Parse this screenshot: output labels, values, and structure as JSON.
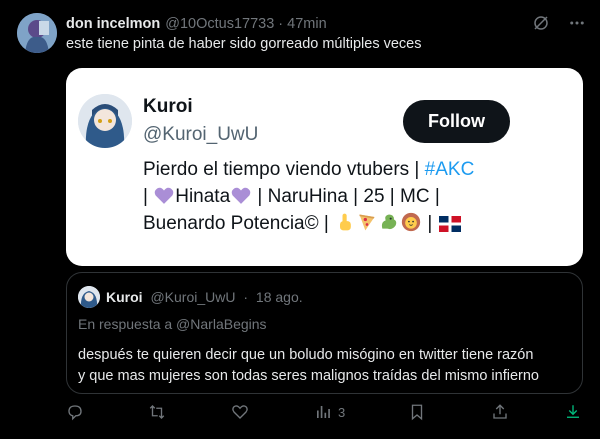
{
  "tweet": {
    "author_name": "don incelmon",
    "author_handle": "@10Octus17733",
    "separator": "·",
    "time": "47min",
    "text": "este tiene pinta de haber sido gorreado múltiples veces"
  },
  "card": {
    "name": "Kuroi",
    "handle": "@Kuroi_UwU",
    "follow_label": "Follow",
    "bio": {
      "line1_text": "Pierdo el tiempo viendo vtubers | ",
      "line1_hashtag": "#AKC",
      "line2_start": "| ",
      "line2_name": "Hinata",
      "line2_end": " | NaruHina | 25 | MC |",
      "line3_text": "Buenardo Potencia© | ",
      "line3_sep": " | "
    }
  },
  "quote": {
    "name": "Kuroi",
    "handle": "@Kuroi_UwU",
    "separator": "·",
    "time": "18 ago.",
    "reply_to": "En respuesta a @NarlaBegins",
    "text_line1": "después te quieren decir que un boludo misógino en twitter tiene razón",
    "text_line2": "y que mas mujeres son todas seres malignos traídas del mismo infierno"
  },
  "actions": {
    "views_count": "3"
  },
  "colors": {
    "background": "#000000",
    "text_primary": "#e7e9ea",
    "text_secondary": "#71767b",
    "link": "#1d9bf0",
    "card_bg": "#ffffff",
    "follow_bg": "#0f1419"
  }
}
